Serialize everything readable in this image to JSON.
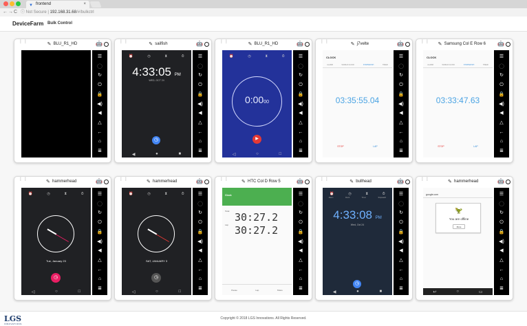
{
  "browser": {
    "tab_title": "frontend",
    "tab_close": "×",
    "security": "Not Secure",
    "url_host": "192.168.31.68",
    "url_path": "/#/bulkctrl"
  },
  "app": {
    "brand": "DeviceFarm",
    "bulk_control": "Bulk Control"
  },
  "controls": [
    "menu-icon",
    "circle-icon",
    "refresh-icon",
    "power-icon",
    "lock-icon",
    "volume-up-icon",
    "volume-down-icon",
    "triangle-icon",
    "back-icon",
    "home-icon",
    "list-icon"
  ],
  "devices": [
    {
      "name": "BLU_R1_HD",
      "screen": "black"
    },
    {
      "name": "sailfish",
      "screen": "dark-clock",
      "time": "4:33:05",
      "ampm": "PM",
      "date": "WED, OCT 24"
    },
    {
      "name": "BLU_R1_HD",
      "screen": "blue-timer",
      "time_main": "0:00",
      "time_sub": "00"
    },
    {
      "name": "j7velte",
      "screen": "white-stopwatch",
      "app_title": "CLOCK",
      "tabs": [
        "ALARM",
        "WORLD CLOCK",
        "STOPWATCH",
        "TIMER"
      ],
      "time": "03:35:55.04",
      "buttons": [
        "STOP",
        "LAP"
      ]
    },
    {
      "name": "Samsung Col E Row 6",
      "screen": "white-stopwatch",
      "app_title": "CLOCK",
      "tabs": [
        "ALARM",
        "WORLD CLOCK",
        "STOPWATCH",
        "TIMER"
      ],
      "time": "03:33:47.63",
      "buttons": [
        "STOP",
        "LAP"
      ]
    },
    {
      "name": "hammerhead",
      "screen": "dark-analog-pink",
      "date": "Tue, January 23"
    },
    {
      "name": "hammerhead",
      "screen": "dark-analog-gray",
      "date": "SAT, JANUARY 3"
    },
    {
      "name": "HTC Col D Row 5",
      "screen": "green-stopwatch",
      "app_title": "Clock",
      "label_total": "Total",
      "label_lap": "Lap",
      "time_total": "30:27.2",
      "time_lap": "30:27.2",
      "bottom": [
        "Pause",
        "Lap",
        "Share"
      ]
    },
    {
      "name": "bullhead",
      "screen": "dark-clock-blue",
      "time": "4:33:08",
      "ampm": "PM",
      "date": "Wed, Oct 24",
      "tabs": [
        "Alarm",
        "Clock",
        "Timer",
        "Stopwatch"
      ]
    },
    {
      "name": "hammerhead",
      "screen": "offline",
      "url": "google.com",
      "offline_text": "You are offline",
      "more": "More"
    }
  ],
  "footer": {
    "logo": "LGS",
    "logo_sub": "INNOVATIONS",
    "copyright": "Copyright © 2018 LGS Innovations. All Rights Reserved."
  }
}
